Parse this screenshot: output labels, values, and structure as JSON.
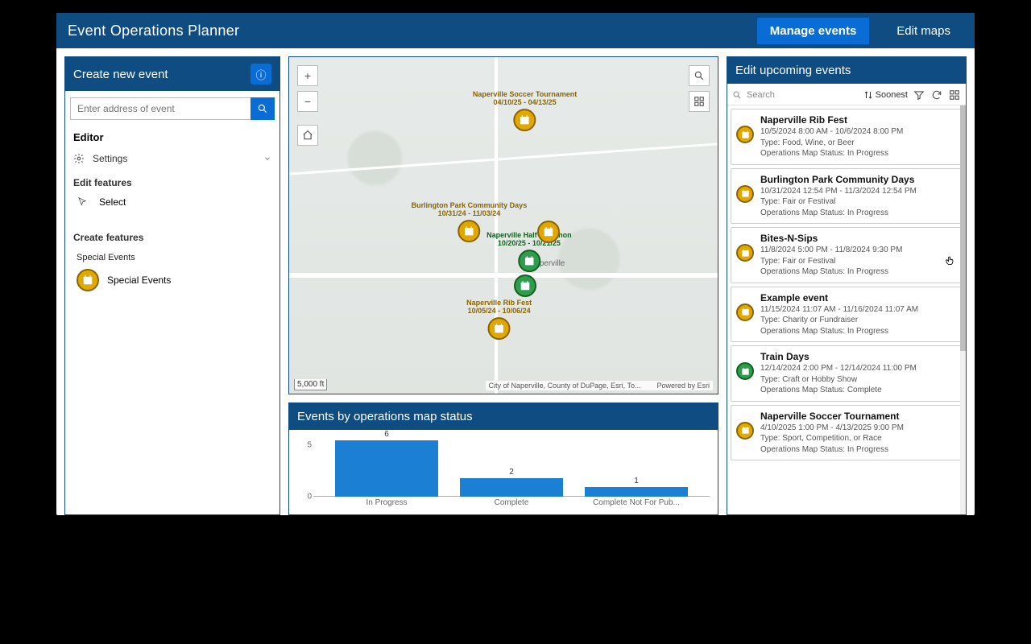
{
  "header": {
    "title": "Event Operations Planner",
    "manage": "Manage events",
    "edit_maps": "Edit maps"
  },
  "left": {
    "title": "Create new event",
    "search_placeholder": "Enter address of event",
    "editor": "Editor",
    "settings": "Settings",
    "edit_features": "Edit features",
    "select": "Select",
    "create_features": "Create features",
    "layer_name": "Special Events",
    "feature_template": "Special Events"
  },
  "map": {
    "scale": "5,000 ft",
    "attribution_left": "City of Naperville, County of DuPage, Esri, To...",
    "attribution_right": "Powered by Esri",
    "places": {
      "naperville": "Naperville"
    },
    "markers": [
      {
        "title": "Naperville Soccer Tournament",
        "dates": "04/10/25 - 04/13/25",
        "color": "gold",
        "x": 55,
        "y": 16
      },
      {
        "title": "Burlington Park Community Days",
        "dates": "10/31/24 - 11/03/24",
        "color": "gold",
        "x": 42,
        "y": 49
      },
      {
        "title": "Naperville Half Marathon",
        "dates": "10/20/25 - 10/21/25",
        "color": "green",
        "x": 56,
        "y": 58
      },
      {
        "title": "Naperville Rib Fest",
        "dates": "10/05/24 - 10/06/24",
        "color": "gold",
        "x": 49,
        "y": 78
      },
      {
        "title": "",
        "dates": "",
        "color": "gold",
        "x": 60.5,
        "y": 52
      },
      {
        "title": "",
        "dates": "",
        "color": "green",
        "x": 55,
        "y": 68
      }
    ]
  },
  "chart_panel": {
    "title": "Events by operations map status"
  },
  "chart_data": {
    "type": "bar",
    "title": "Events by operations map status",
    "xlabel": "",
    "ylabel": "",
    "ylim": [
      0,
      6
    ],
    "yticks": [
      0,
      5
    ],
    "categories": [
      "In Progress",
      "Complete",
      "Complete Not For Pub..."
    ],
    "values": [
      6,
      2,
      1
    ]
  },
  "right": {
    "title": "Edit upcoming events",
    "search_placeholder": "Search",
    "sort_label": "Soonest",
    "events": [
      {
        "title": "Naperville Rib Fest",
        "dates": "10/5/2024 8:00 AM - 10/6/2024 8:00 PM",
        "type": "Type: Food, Wine, or Beer",
        "status": "Operations Map Status: In Progress",
        "color": "gold"
      },
      {
        "title": "Burlington Park Community Days",
        "dates": "10/31/2024 12:54 PM - 11/3/2024 12:54 PM",
        "type": "Type: Fair or Festival",
        "status": "Operations Map Status: In Progress",
        "color": "gold"
      },
      {
        "title": "Bites-N-Sips",
        "dates": "11/8/2024 5:00 PM - 11/8/2024 9:30 PM",
        "type": "Type: Fair or Festival",
        "status": "Operations Map Status: In Progress",
        "color": "gold"
      },
      {
        "title": "Example event",
        "dates": "11/15/2024 11:07 AM - 11/16/2024 11:07 AM",
        "type": "Type: Charity or Fundraiser",
        "status": "Operations Map Status: In Progress",
        "color": "gold"
      },
      {
        "title": "Train Days",
        "dates": "12/14/2024 2:00 PM - 12/14/2024 11:00 PM",
        "type": "Type: Craft or Hobby Show",
        "status": "Operations Map Status: Complete",
        "color": "green"
      },
      {
        "title": "Naperville Soccer Tournament",
        "dates": "4/10/2025 1:00 PM - 4/13/2025 9:00 PM",
        "type": "Type: Sport, Competition, or Race",
        "status": "Operations Map Status: In Progress",
        "color": "gold"
      }
    ]
  }
}
